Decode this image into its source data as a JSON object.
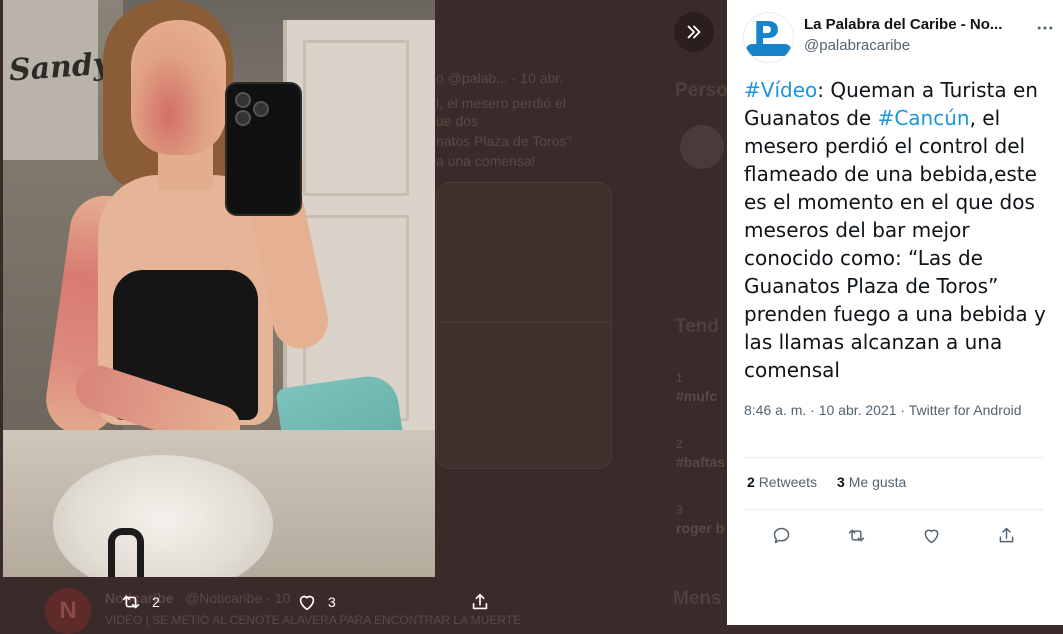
{
  "tweet": {
    "author_name": "La Palabra del Caribe - No...",
    "author_handle": "@palabracaribe",
    "text_parts": [
      {
        "text": "#Vídeo",
        "tag": true
      },
      {
        "text": ": Queman a Turista en Guanatos de ",
        "tag": false
      },
      {
        "text": "#Cancún",
        "tag": true
      },
      {
        "text": ", el mesero perdió el control del flameado de una bebida,este es el momento en el que dos meseros del bar mejor conocido como: “Las de Guanatos Plaza de Toros” prenden fuego a una bebida y las llamas alcanzan a una comensal",
        "tag": false
      }
    ],
    "timestamp": "8:46 a. m. · 10 abr. 2021 · Twitter for Android",
    "retweets_count": "2",
    "retweets_label": "Retweets",
    "likes_count": "3",
    "likes_label": "Me gusta"
  },
  "photo_actions": {
    "retweet_count": "2",
    "like_count": "3"
  },
  "background": {
    "line1": "o @palab... · 10 abr.",
    "line2": "l, el mesero perdió el",
    "line3": "ue dos",
    "line4": "natos Plaza de Toros\"",
    "line5": "a una comensal",
    "sidebar_who": "Perso",
    "trends": "Tend",
    "trend1_num": "1",
    "trend1": "#mufc",
    "trend2_num": "2",
    "trend2": "#baftas",
    "trend3_num": "3",
    "trend3": "roger b",
    "messages": "Mens",
    "bottom_name": "Noticaribe",
    "bottom_handle": "@Noticaribe · 10",
    "bottom_text": "VIDEO | SE METIÓ AL CENOTE ALAVERA PARA ENCONTRAR LA MUERTE",
    "bottom_logo": "N"
  },
  "photo_sign_text": "Sandy",
  "colors": {
    "accent": "#1b95e0",
    "text_primary": "#0f1419",
    "text_secondary": "#536471",
    "backdrop": "#3a2b2a"
  },
  "icons": {
    "expand": "double-chevron-right-icon",
    "more": "ellipsis-icon",
    "reply": "reply-icon",
    "retweet": "retweet-icon",
    "like": "heart-icon",
    "share": "share-icon"
  }
}
